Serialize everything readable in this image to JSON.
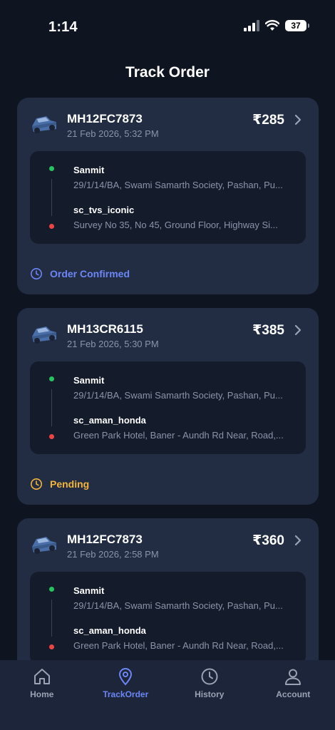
{
  "status_bar": {
    "time": "1:14",
    "battery": "37"
  },
  "page": {
    "title": "Track Order"
  },
  "colors": {
    "accent": "#6d86f5",
    "confirmed": "#6d86f5",
    "pending": "#f2b53a",
    "pickup_dot": "#22c55e",
    "drop_dot": "#ef4444"
  },
  "orders": [
    {
      "vehicle_no": "MH12FC7873",
      "date": "21 Feb 2026, 5:32 PM",
      "price": "₹285",
      "pickup": {
        "name": "Sanmit",
        "address": "29/1/14/BA, Swami Samarth Society, Pashan, Pu..."
      },
      "drop": {
        "name": "sc_tvs_iconic",
        "address": "Survey No 35, No 45, Ground Floor, Highway Si..."
      },
      "status": "Order Confirmed",
      "status_color": "#6d86f5"
    },
    {
      "vehicle_no": "MH13CR6115",
      "date": "21 Feb 2026, 5:30 PM",
      "price": "₹385",
      "pickup": {
        "name": "Sanmit",
        "address": "29/1/14/BA, Swami Samarth Society, Pashan, Pu..."
      },
      "drop": {
        "name": "sc_aman_honda",
        "address": "Green Park Hotel, Baner - Aundh Rd Near, Road,..."
      },
      "status": "Pending",
      "status_color": "#f2b53a"
    },
    {
      "vehicle_no": "MH12FC7873",
      "date": "21 Feb 2026, 2:58 PM",
      "price": "₹360",
      "pickup": {
        "name": "Sanmit",
        "address": "29/1/14/BA, Swami Samarth Society, Pashan, Pu..."
      },
      "drop": {
        "name": "sc_aman_honda",
        "address": "Green Park Hotel, Baner - Aundh Rd Near, Road,..."
      },
      "status": "",
      "status_color": "#6d86f5"
    }
  ],
  "nav": {
    "items": [
      {
        "label": "Home",
        "icon": "home-icon"
      },
      {
        "label": "TrackOrder",
        "icon": "location-pin-icon",
        "active": true
      },
      {
        "label": "History",
        "icon": "clock-icon"
      },
      {
        "label": "Account",
        "icon": "user-icon"
      }
    ]
  }
}
